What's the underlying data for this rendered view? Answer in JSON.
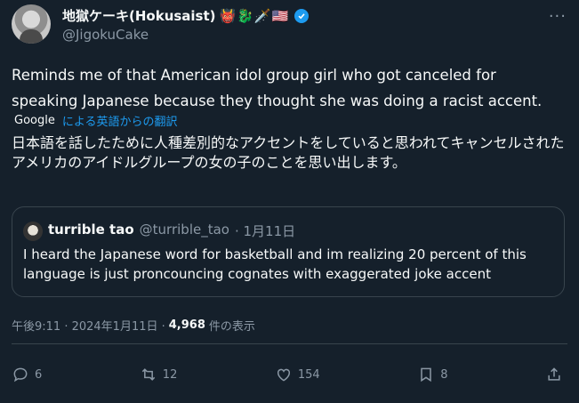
{
  "author": {
    "display_name": "地獄ケーキ(Hokusaist)",
    "emojis": "👹🐉🗡️🇺🇸",
    "handle": "@JigokuCake"
  },
  "tweet": {
    "text": "Reminds me of that American idol group girl who got canceled for speaking Japanese because they thought she was doing a racist accent.",
    "translate_logo": "Google",
    "translate_link": "による英語からの翻訳",
    "translated_text": "日本語を話したために人種差別的なアクセントをしていると思われてキャンセルされたアメリカのアイドルグループの女の子のことを思い出します。"
  },
  "quote": {
    "name": "turrible tao",
    "handle": "@turrible_tao",
    "date": "· 1月11日",
    "text": "I heard the Japanese word for basketball and im realizing 20 percent of this language is just proncouncing cognates with exaggerated joke accent"
  },
  "meta": {
    "time": "午後9:11 · 2024年1月11日 ·",
    "views": "4,968",
    "views_label": "件の表示"
  },
  "actions": {
    "replies": "6",
    "retweets": "12",
    "likes": "154",
    "bookmarks": "8"
  }
}
